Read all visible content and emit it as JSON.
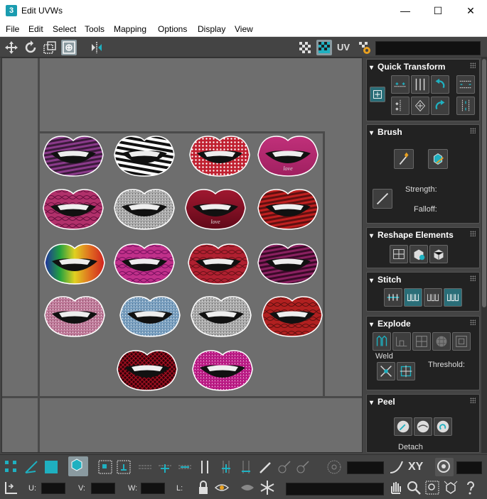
{
  "window": {
    "title": "Edit UVWs",
    "app_icon": "3",
    "minimize": "—",
    "maximize": "☐",
    "close": "✕"
  },
  "menu": [
    "File",
    "Edit",
    "Select",
    "Tools",
    "Mapping",
    "Options",
    "Display",
    "View"
  ],
  "toolbar": {
    "uv_label": "UV"
  },
  "rollouts": {
    "quick_transform": {
      "title": "Quick Transform"
    },
    "brush": {
      "title": "Brush",
      "strength_label": "Strength:",
      "falloff_label": "Falloff:"
    },
    "reshape": {
      "title": "Reshape Elements"
    },
    "stitch": {
      "title": "Stitch"
    },
    "explode": {
      "title": "Explode",
      "weld_label": "Weld",
      "threshold_label": "Threshold:"
    },
    "peel": {
      "title": "Peel",
      "detach_label": "Detach"
    }
  },
  "lips_text": {
    "love1": "ᴸᵒᵛᵉ",
    "love2": "love"
  },
  "bottom": {
    "xy_label": "XY",
    "u_label": "U:",
    "v_label": "V:",
    "w_label": "W:",
    "l_label": "L:"
  },
  "colors": {
    "accent": "#1fb0c0",
    "bg": "#444444",
    "viewport": "#6e6e6e"
  }
}
